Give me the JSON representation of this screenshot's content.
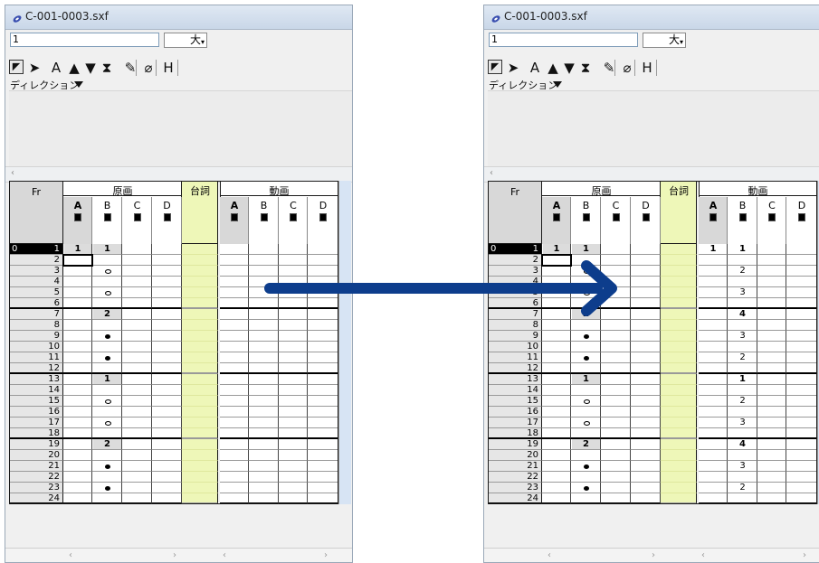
{
  "title": "C-001-0003.sxf",
  "frame_value": "1",
  "size_label": "大",
  "direction_label": "ディレクション",
  "headers": {
    "fr": "Fr",
    "genga": "原画",
    "serifu": "台詞",
    "douga": "動画",
    "layers": [
      "A",
      "B",
      "C",
      "D"
    ]
  },
  "frames": [
    "1",
    "2",
    "3",
    "4",
    "5",
    "6",
    "7",
    "8",
    "9",
    "10",
    "11",
    "12",
    "13",
    "14",
    "15",
    "16",
    "17",
    "18",
    "19",
    "20",
    "21",
    "22",
    "23",
    "24"
  ],
  "second_marker": "0",
  "genga_before": {
    "A": {
      "1": "1"
    },
    "B": {
      "1": "1",
      "3": "○",
      "5": "○",
      "7": "2",
      "9": "●",
      "11": "●",
      "13": "1",
      "15": "○",
      "17": "○",
      "19": "2",
      "21": "●",
      "23": "●"
    }
  },
  "genga_after": {
    "A": {
      "1": "1"
    },
    "B": {
      "1": "1",
      "3": "○",
      "5": "○",
      "7": "2",
      "9": "●",
      "11": "●",
      "13": "1",
      "15": "○",
      "17": "○",
      "19": "2",
      "21": "●",
      "23": "●"
    }
  },
  "douga_after": {
    "A": {
      "1": "1"
    },
    "B": {
      "1": "1",
      "3": "2",
      "5": "3",
      "7": "4",
      "9": "3",
      "11": "2",
      "13": "1",
      "15": "2",
      "17": "3",
      "19": "4",
      "21": "3",
      "23": "2"
    }
  },
  "colors": {
    "accent_arrow": "#0d3d8c",
    "serifu_column": "#eef7b8",
    "selected_frame": "#000000"
  },
  "icons": [
    "select-icon",
    "arrow-tool-icon",
    "text-tool-icon",
    "up-tool-icon",
    "down-tool-icon",
    "hourglass-tool-icon",
    "pencil-icon",
    "eraser-icon",
    "hold-tool-icon"
  ]
}
